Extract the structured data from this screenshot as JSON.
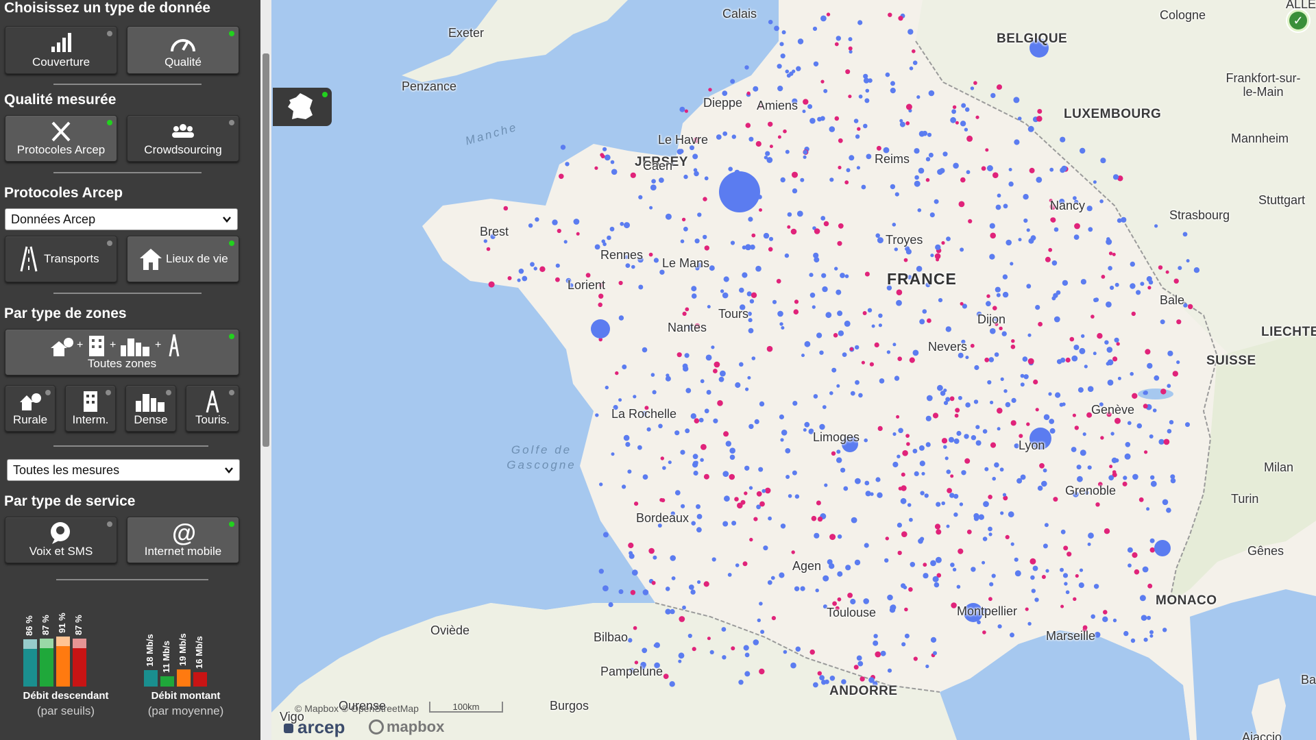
{
  "sidebar": {
    "type_title": "Choisissez un type de donnée",
    "type_buttons": [
      {
        "label": "Couverture",
        "icon": "signal-bars-icon",
        "active": false
      },
      {
        "label": "Qualité",
        "icon": "speedometer-icon",
        "active": true
      }
    ],
    "quality_title": "Qualité mesurée",
    "quality_buttons": [
      {
        "label": "Protocoles Arcep",
        "icon": "tools-icon",
        "active": true
      },
      {
        "label": "Crowdsourcing",
        "icon": "people-icon",
        "active": false
      }
    ],
    "protocols_title": "Protocoles Arcep",
    "protocol_select": "Données Arcep",
    "protocol_buttons": [
      {
        "label": "Transports",
        "icon": "road-icon",
        "active": false
      },
      {
        "label": "Lieux de vie",
        "icon": "house-icon",
        "active": true
      }
    ],
    "zones_title": "Par type de zones",
    "all_zones_label": "Toutes zones",
    "zone_buttons": [
      {
        "label": "Rurale",
        "icon": "rural-icon"
      },
      {
        "label": "Interm.",
        "icon": "building-icon"
      },
      {
        "label": "Dense",
        "icon": "city-icon"
      },
      {
        "label": "Touris.",
        "icon": "eiffel-tower-icon"
      }
    ],
    "measures_select": "Toutes les mesures",
    "service_title": "Par type de service",
    "service_buttons": [
      {
        "label": "Voix et SMS",
        "icon": "chat-icon",
        "active": false
      },
      {
        "label": "Internet mobile",
        "icon": "at-icon",
        "active": true
      }
    ],
    "download_caption": "Débit descendant",
    "download_sub": "(par seuils)",
    "upload_caption": "Débit montant",
    "upload_sub": "(par moyenne)"
  },
  "chart_data": [
    {
      "type": "bar",
      "title": "Débit descendant",
      "subtitle": "(par seuils)",
      "categories": [
        "Orange-teal",
        "Green",
        "Orange",
        "Red"
      ],
      "values": [
        86,
        87,
        91,
        87
      ],
      "value_labels": [
        "86 %",
        "87 %",
        "91 %",
        "87 %"
      ],
      "colors": [
        "#1a8f8f",
        "#1fa83a",
        "#ff7a10",
        "#c81414"
      ],
      "ylim": [
        0,
        100
      ]
    },
    {
      "type": "bar",
      "title": "Débit montant",
      "subtitle": "(par moyenne)",
      "categories": [
        "Teal",
        "Green",
        "Orange",
        "Red"
      ],
      "values": [
        18,
        11,
        19,
        16
      ],
      "value_labels": [
        "18 Mb/s",
        "11 Mb/s",
        "19 Mb/s",
        "16 Mb/s"
      ],
      "colors": [
        "#1a8f8f",
        "#1fa83a",
        "#ff7a10",
        "#c81414"
      ],
      "ylim": [
        0,
        60
      ]
    }
  ],
  "map": {
    "seas": [
      "Manche",
      "Golfe de Gascogne"
    ],
    "countries": [
      "BELGIQUE",
      "LUXEMBOURG",
      "FRANCE",
      "SUISSE",
      "LIECHTEN",
      "ANDORRE",
      "MONACO",
      "JERSEY"
    ],
    "cities": [
      "Calais",
      "Exeter",
      "Penzance",
      "Dieppe",
      "Amiens",
      "Le Havre",
      "Caen",
      "Reims",
      "Brest",
      "Rennes",
      "Le Mans",
      "Lorient",
      "Troyes",
      "Nancy",
      "Strasbourg",
      "Tours",
      "Nantes",
      "Dijon",
      "Nevers",
      "Bale",
      "La Rochelle",
      "Limoges",
      "Lyon",
      "Genève",
      "Grenoble",
      "Bordeaux",
      "Agen",
      "Toulouse",
      "Montpellier",
      "Marseille",
      "Oviède",
      "Bilbao",
      "Pampelune",
      "Burgos",
      "Ourense",
      "Vigo",
      "Cologne",
      "Frankfort-sur-le-Main",
      "Mannheim",
      "Stuttgart",
      "Turin",
      "Milan",
      "Gênes",
      "Bastia",
      "Ajaccio",
      "ALLE"
    ],
    "attribution": "© Mapbox © OpenStreetMap",
    "scale": "100km",
    "brand": "arcep",
    "mapbox": "mapbox",
    "colors": {
      "sea": "#a6c8ef",
      "land": "#f4f1ea",
      "foreign": "#eef0e4",
      "dot_blue": "#5b7cf0",
      "dot_pink": "#e0237a"
    }
  }
}
